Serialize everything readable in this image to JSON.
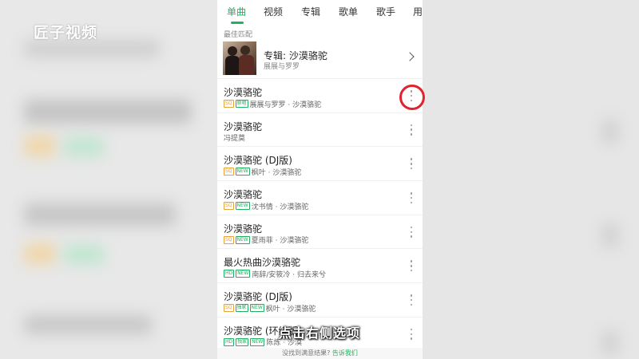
{
  "watermark": "匠子视频",
  "tabs": [
    "单曲",
    "视频",
    "专辑",
    "歌单",
    "歌手",
    "用"
  ],
  "best_match": {
    "section_label": "最佳匹配",
    "title": "专辑: 沙漠骆驼",
    "artist": "展展与罗罗"
  },
  "songs": [
    {
      "title": "沙漠骆驼",
      "badges": [
        "SQ",
        "原唱"
      ],
      "artist": "展展与罗罗 · 沙漠骆驼"
    },
    {
      "title": "沙漠骆驼",
      "badges": [],
      "artist": "冯提莫"
    },
    {
      "title": "沙漠骆驼 (DJ版)",
      "badges": [
        "SQ",
        "NEW"
      ],
      "artist": "枫叶 · 沙漠骆驼"
    },
    {
      "title": "沙漠骆驼",
      "badges": [
        "SQ",
        "NEW"
      ],
      "artist": "沈书情 · 沙漠骆驼"
    },
    {
      "title": "沙漠骆驼",
      "badges": [
        "SQ",
        "NEW"
      ],
      "artist": "夏雨菲 · 沙漠骆驼"
    },
    {
      "title": "最火热曲沙漠骆驼",
      "badges": [
        "HD",
        "NEW"
      ],
      "artist": "南辞/安筱冷 · 归去来兮"
    },
    {
      "title": "沙漠骆驼 (DJ版)",
      "badges": [
        "SQ",
        "独家",
        "NEW"
      ],
      "artist": "枫叶 · 沙漠骆驼"
    },
    {
      "title": "沙漠骆驼 (环绕版)",
      "badges": [
        "HD",
        "独家",
        "NEW"
      ],
      "artist": "陈炼 · 沙漠"
    }
  ],
  "footer": {
    "question": "没找到满意结果?",
    "link": "告诉我们"
  },
  "subtitle": "点击右侧选项",
  "colors": {
    "accent": "#20b060",
    "sq_badge": "#e8a23a",
    "highlight": "#e0232e"
  }
}
